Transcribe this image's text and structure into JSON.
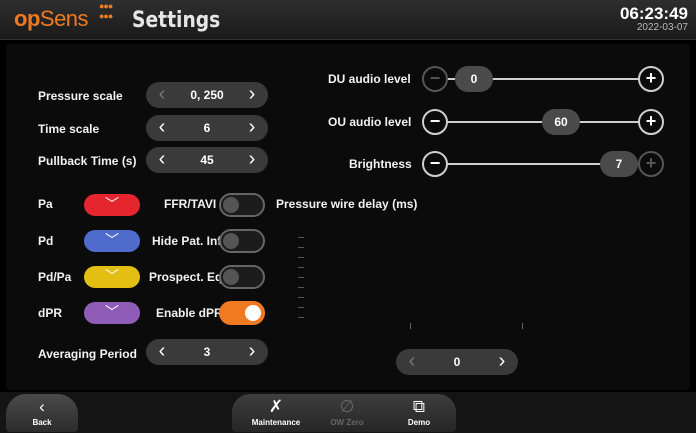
{
  "header": {
    "logo_op": "op",
    "logo_sens": "Sens",
    "title": "Settings",
    "time": "06:23:49",
    "date": "2022-03-07"
  },
  "left": {
    "pressure_scale": {
      "label": "Pressure scale",
      "value": "0, 250"
    },
    "time_scale": {
      "label": "Time scale",
      "value": "6"
    },
    "pullback_time": {
      "label": "Pullback Time (s)",
      "value": "45"
    },
    "averaging_period": {
      "label": "Averaging Period",
      "value": "3"
    },
    "channels": [
      {
        "label": "Pa",
        "color": "#e5252e"
      },
      {
        "label": "Pd",
        "color": "#4f6ccc"
      },
      {
        "label": "Pd/Pa",
        "color": "#e3bf14"
      },
      {
        "label": "dPR",
        "color": "#8f5cb8"
      }
    ]
  },
  "toggles": [
    {
      "label": "FFR/TAVI",
      "on": false
    },
    {
      "label": "Hide Pat. Info",
      "on": false
    },
    {
      "label": "Prospect. Eq.",
      "on": false
    },
    {
      "label": "Enable dPR",
      "on": true,
      "color": "#f07a22"
    }
  ],
  "right": {
    "du_audio": {
      "label": "DU audio level",
      "value": "0"
    },
    "ou_audio": {
      "label": "OU audio level",
      "value": "60"
    },
    "brightness": {
      "label": "Brightness",
      "value": "7"
    },
    "pressure_wire_delay": {
      "label": "Pressure wire delay (ms)",
      "value": "0"
    }
  },
  "footer": {
    "back": {
      "label": "Back",
      "icon": "chevron-left-icon"
    },
    "maintenance": {
      "label": "Maintenance",
      "icon": "tools-icon"
    },
    "ow_zero": {
      "label": "OW Zero",
      "icon": "null-icon"
    },
    "demo": {
      "label": "Demo",
      "icon": "demo-icon"
    }
  },
  "colors": {
    "accent": "#f07a22",
    "control": "#3a3a3a",
    "background": "#000000"
  }
}
